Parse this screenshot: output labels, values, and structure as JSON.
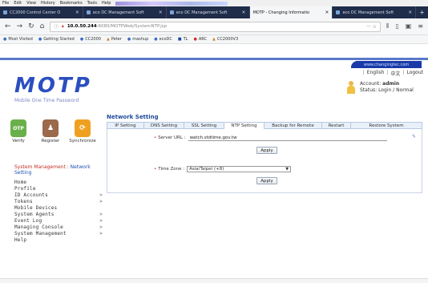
{
  "browser": {
    "menu": [
      "File",
      "Edit",
      "View",
      "History",
      "Bookmarks",
      "Tools",
      "Help"
    ],
    "tabs": [
      {
        "label": "CC2000 Control Center O"
      },
      {
        "label": "eco DC Management Soft"
      },
      {
        "label": "eco DC Management Soft"
      },
      {
        "label": "MOTP - Changing Informatio"
      },
      {
        "label": "eco DC Management Soft"
      }
    ],
    "new_tab_label": "+",
    "url": {
      "host": "10.0.50.244",
      "path": ":6080/MOTPWeb/SystemNTP.jsp",
      "right": "··· ☆"
    },
    "bookmarks": [
      "Most Visited",
      "Getting Started",
      "CC2000",
      "Peter",
      "mashup",
      "ecoDC",
      "TL",
      "ARC",
      "CC2000V3"
    ]
  },
  "header": {
    "changingtabs": "www.changingtec.com",
    "logo": "MOTP",
    "tagline": "Mobile One Time Password",
    "lang_links": [
      "English",
      "中文",
      "Logout"
    ],
    "account_label": "Account:",
    "account_value": "admin",
    "status_label": "Status:",
    "status_value": "Login / Normal"
  },
  "quick_actions": [
    {
      "label": "Verify",
      "glyph": "OTP"
    },
    {
      "label": "Register",
      "glyph": "♟"
    },
    {
      "label": "Synchronize",
      "glyph": "⟳"
    }
  ],
  "breadcrumb": {
    "first": "System Management",
    "sep": " : ",
    "second": "Network Setting"
  },
  "sidemenu": [
    {
      "label": "Home",
      "arrow": ""
    },
    {
      "label": "Profile",
      "arrow": ""
    },
    {
      "label": "ID Accounts",
      "arrow": ">"
    },
    {
      "label": "Tokens",
      "arrow": ">"
    },
    {
      "label": "Mobile Devices",
      "arrow": ""
    },
    {
      "label": "System Agents",
      "arrow": ">"
    },
    {
      "label": "Event Log",
      "arrow": ">"
    },
    {
      "label": "Managing Console",
      "arrow": ">"
    },
    {
      "label": "System Management",
      "arrow": ">"
    },
    {
      "label": "Help",
      "arrow": ""
    }
  ],
  "main": {
    "title": "Network Setting",
    "tabs": [
      {
        "label": "IP Setting"
      },
      {
        "label": "DNS Setting"
      },
      {
        "label": "SSL Setting"
      },
      {
        "label": "NTP Setting"
      },
      {
        "label": "Backup for Remote"
      },
      {
        "label": "Restart"
      },
      {
        "label": "Restore System"
      }
    ],
    "server_url_label": "Server URL :",
    "server_url_value": "watch.stdtime.gov.tw",
    "apply1": "Apply",
    "timezone_label": "Time Zone :",
    "timezone_value": "Asia/Taipei (+8)",
    "apply2": "Apply"
  },
  "colors": {
    "accent": "#2b4fbf",
    "tabbar": "#1f2c4a",
    "crumb_red": "#c03020"
  }
}
